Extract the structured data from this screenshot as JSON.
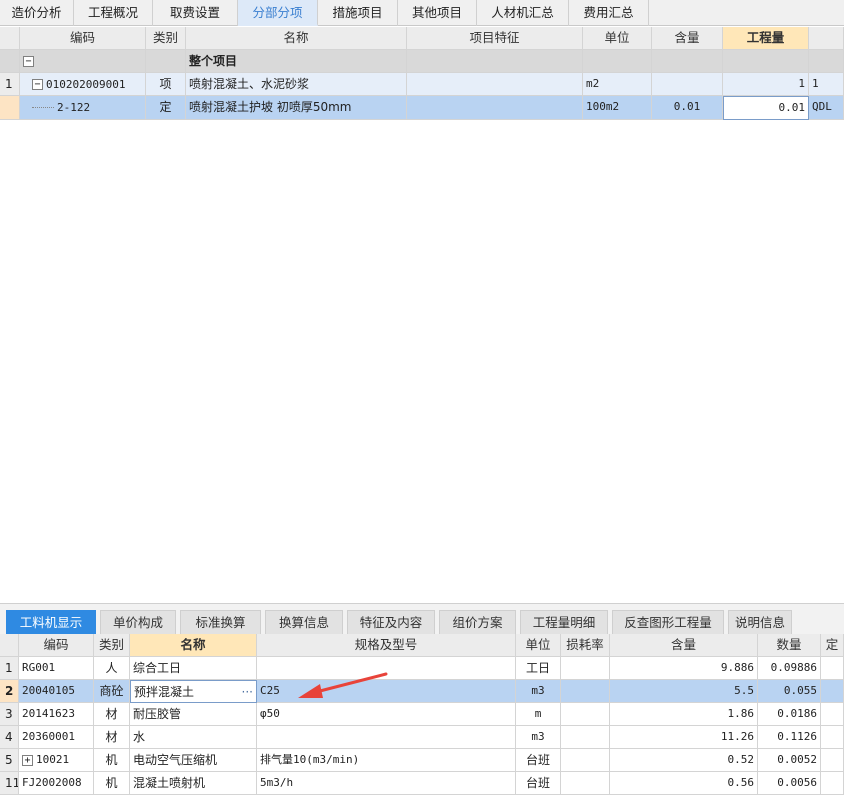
{
  "top_tabs": [
    {
      "label": "造价分析",
      "active": false
    },
    {
      "label": "工程概况",
      "active": false
    },
    {
      "label": "取费设置",
      "active": false
    },
    {
      "label": "分部分项",
      "active": true
    },
    {
      "label": "措施项目",
      "active": false
    },
    {
      "label": "其他项目",
      "active": false
    },
    {
      "label": "人材机汇总",
      "active": false
    },
    {
      "label": "费用汇总",
      "active": false
    }
  ],
  "upper_grid": {
    "headers": [
      "",
      "编码",
      "类别",
      "名称",
      "项目特征",
      "单位",
      "含量",
      "工程量",
      ""
    ],
    "group_row": {
      "expander": "−",
      "title": "整个项目"
    },
    "item_row": {
      "num": "1",
      "expander": "−",
      "code": "010202009001",
      "type": "项",
      "name": "喷射混凝土、水泥砂浆",
      "feature": "",
      "unit": "m2",
      "content": "",
      "quantity": "1",
      "extra": "1"
    },
    "sub_row": {
      "num": "",
      "code": "2-122",
      "type": "定",
      "name": "喷射混凝土护坡 初喷厚50mm",
      "feature": "",
      "unit": "100m2",
      "content": "0.01",
      "quantity": "0.01",
      "extra": "QDL"
    }
  },
  "bottom_tabs": [
    {
      "label": "工料机显示",
      "active": true
    },
    {
      "label": "单价构成",
      "active": false
    },
    {
      "label": "标准换算",
      "active": false
    },
    {
      "label": "换算信息",
      "active": false
    },
    {
      "label": "特征及内容",
      "active": false
    },
    {
      "label": "组价方案",
      "active": false
    },
    {
      "label": "工程量明细",
      "active": false
    },
    {
      "label": "反查图形工程量",
      "active": false
    },
    {
      "label": "说明信息",
      "active": false
    }
  ],
  "lower_grid": {
    "headers": [
      "",
      "编码",
      "类别",
      "名称",
      "规格及型号",
      "单位",
      "损耗率",
      "含量",
      "数量",
      "定"
    ],
    "rows": [
      {
        "num": "1",
        "code": "RG001",
        "type": "人",
        "name": "综合工日",
        "spec": "",
        "unit": "工日",
        "loss": "",
        "content": "9.886",
        "qty": "0.09886",
        "selected": false,
        "expander": ""
      },
      {
        "num": "2",
        "code": "20040105",
        "type": "商砼",
        "name": "预拌混凝土",
        "spec": "C25",
        "unit": "m3",
        "loss": "",
        "content": "5.5",
        "qty": "0.055",
        "selected": true,
        "expander": ""
      },
      {
        "num": "3",
        "code": "20141623",
        "type": "材",
        "name": "耐压胶管",
        "spec": "φ50",
        "unit": "m",
        "loss": "",
        "content": "1.86",
        "qty": "0.0186",
        "selected": false,
        "expander": ""
      },
      {
        "num": "4",
        "code": "20360001",
        "type": "材",
        "name": "水",
        "spec": "",
        "unit": "m3",
        "loss": "",
        "content": "11.26",
        "qty": "0.1126",
        "selected": false,
        "expander": ""
      },
      {
        "num": "5",
        "code": "10021",
        "type": "机",
        "name": "电动空气压缩机",
        "spec": "排气量10(m3/min)",
        "unit": "台班",
        "loss": "",
        "content": "0.52",
        "qty": "0.0052",
        "selected": false,
        "expander": "+"
      },
      {
        "num": "11",
        "code": "FJ2002008",
        "type": "机",
        "name": "混凝土喷射机",
        "spec": "5m3/h",
        "unit": "台班",
        "loss": "",
        "content": "0.56",
        "qty": "0.0056",
        "selected": false,
        "expander": ""
      }
    ],
    "ellipsis": "···"
  },
  "colors": {
    "active_tab": "#2f8ae2",
    "selected_row": "#b9d3f2",
    "arrow": "#e8433a"
  }
}
